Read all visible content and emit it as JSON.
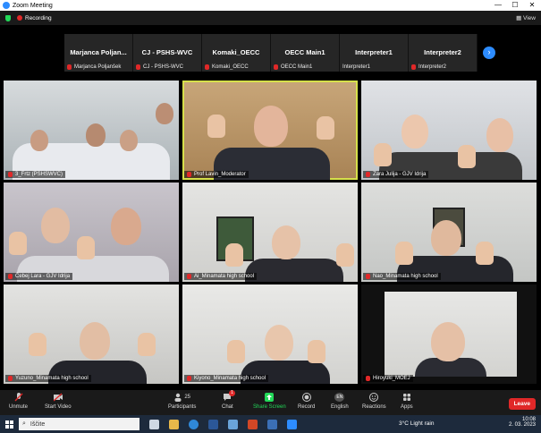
{
  "window": {
    "title": "Zoom Meeting",
    "minimize": "—",
    "maximize": "☐",
    "close": "✕"
  },
  "topbar": {
    "recording_label": "Recording",
    "view_label": "View"
  },
  "filmstrip": [
    {
      "display_name": "Marjanca  Poljan...",
      "sub_name": "Marjanca Poljanšek"
    },
    {
      "display_name": "CJ - PSHS-WVC",
      "sub_name": "CJ - PSHS-WVC"
    },
    {
      "display_name": "Komaki_OECC",
      "sub_name": "Komaki_OECC"
    },
    {
      "display_name": "OECC Main1",
      "sub_name": "OECC Main1"
    },
    {
      "display_name": "Interpreter1",
      "sub_name": "Interpreter1"
    },
    {
      "display_name": "Interpreter2",
      "sub_name": "Interpreter2"
    }
  ],
  "tiles": [
    {
      "label": "3_Frtz (PSHSWVC)"
    },
    {
      "label": "Prof Lavin_Moderator"
    },
    {
      "label": "Zara Julija - GJV Idrija"
    },
    {
      "label": "Čebej Lara - GJV Idrija"
    },
    {
      "label": "Ai_Minamata high school"
    },
    {
      "label": "Nao_Minamata high school"
    },
    {
      "label": "Yuzuno_Minamata high school"
    },
    {
      "label": "Kiyono_Minamata high school"
    },
    {
      "label": "Hiroyuki_MOEJ"
    }
  ],
  "toolbar": {
    "unmute": "Unmute",
    "start_video": "Start Video",
    "participants": "Participants",
    "participants_count": "25",
    "chat": "Chat",
    "chat_badge": "1",
    "share_screen": "Share Screen",
    "record": "Record",
    "english": "English",
    "english_badge": "EN",
    "reactions": "Reactions",
    "apps": "Apps",
    "leave": "Leave"
  },
  "taskbar": {
    "search_placeholder": "Iščite",
    "weather": "3°C  Light rain",
    "time": "10:08",
    "date": "2. 03. 2023"
  },
  "colors": {
    "accent": "#2d8cff",
    "share_green": "#23d959",
    "leave_red": "#e02828",
    "active_outline": "#d6e04a"
  }
}
